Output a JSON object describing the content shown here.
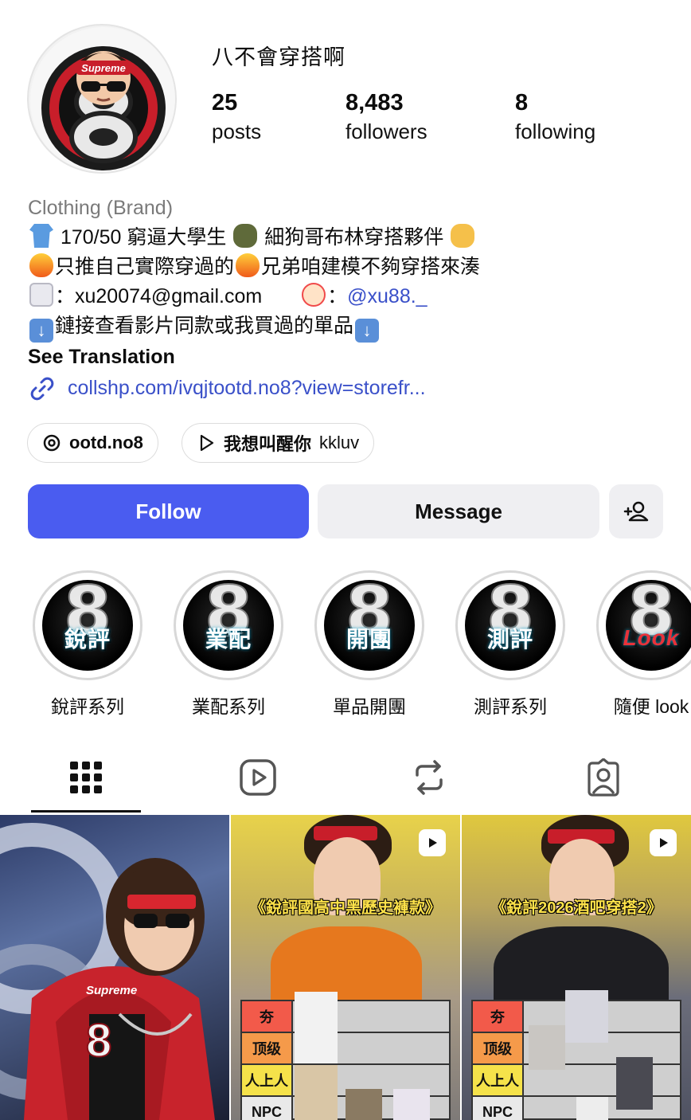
{
  "profile": {
    "username": "八不會穿搭啊",
    "stats": [
      {
        "value": "25",
        "label": "posts"
      },
      {
        "value": "8,483",
        "label": "followers"
      },
      {
        "value": "8",
        "label": "following"
      }
    ]
  },
  "bio": {
    "category": "Clothing (Brand)",
    "line1": "170/50 窮逼大學生",
    "line1b": "細狗哥布林穿搭夥伴",
    "line2a": "只推自己實際穿過的",
    "line2b": "兄弟咱建模不夠穿搭來湊",
    "line3_email": "：xu20074@gmail.com",
    "line3_sep": "：",
    "line3_mention": "@xu88._",
    "line4": "鏈接查看影片同款或我買過的單品",
    "see_translation": "See Translation",
    "link": "collshp.com/ivqjtootd.no8?view=storefr..."
  },
  "chips": {
    "threads": "ootd.no8",
    "music_song": "我想叫醒你",
    "music_artist": "kkluv"
  },
  "actions": {
    "follow": "Follow",
    "message": "Message"
  },
  "highlights": [
    {
      "tag": "銳評",
      "label": "銳評系列"
    },
    {
      "tag": "業配",
      "label": "業配系列"
    },
    {
      "tag": "開團",
      "label": "單品開團"
    },
    {
      "tag": "測評",
      "label": "測評系列"
    },
    {
      "tag": "Look",
      "label": "隨便 look"
    }
  ],
  "grid": {
    "cell1_number": "8",
    "cell1_headband": "Supreme",
    "cell2_caption": "《銳評國高中黑歷史褲款》",
    "cell3_caption": "《銳評2026酒吧穿搭2》",
    "tiers": [
      "夯",
      "顶级",
      "人上人",
      "NPC"
    ]
  },
  "colors": {
    "follow_button": "#4a5cf0",
    "link": "#3a50c9",
    "category": "#7a7a7a"
  }
}
